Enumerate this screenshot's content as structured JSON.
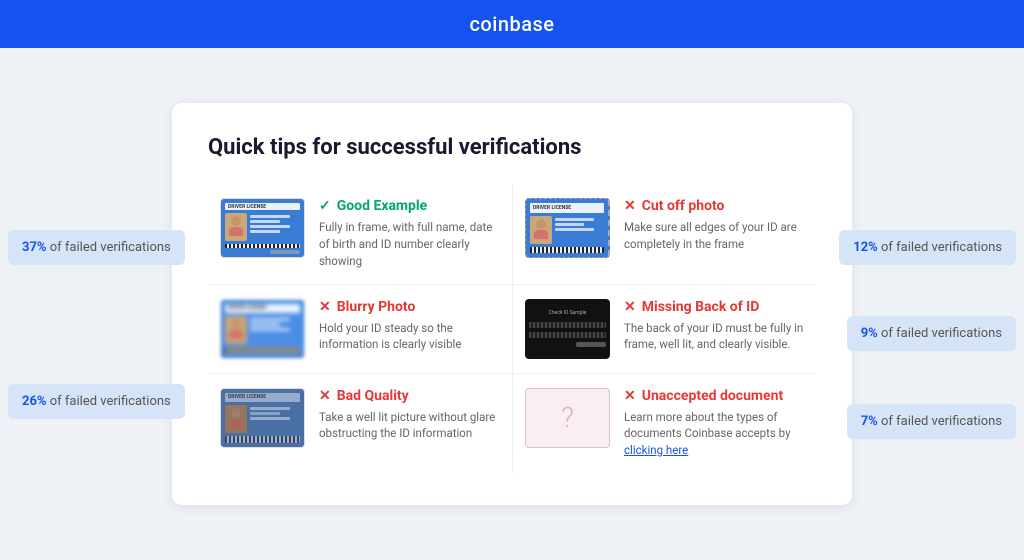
{
  "header": {
    "logo": "coinbase"
  },
  "page": {
    "title": "Quick tips for successful verifications"
  },
  "left_badges": [
    {
      "id": "badge-left-37",
      "pct": "37%",
      "text": " of failed verifications"
    },
    {
      "id": "badge-left-26",
      "pct": "26%",
      "text": " of failed verifications"
    }
  ],
  "right_badges": [
    {
      "id": "badge-right-12",
      "pct": "12%",
      "text": " of failed verifications"
    },
    {
      "id": "badge-right-9",
      "pct": "9%",
      "text": " of failed verifications"
    },
    {
      "id": "badge-right-7",
      "pct": "7%",
      "text": " of failed verifications"
    }
  ],
  "tips": [
    {
      "id": "good-example",
      "icon": "check",
      "title": "Good Example",
      "title_class": "good",
      "description": "Fully in frame, with full name, date of birth and ID number clearly showing",
      "image_type": "good"
    },
    {
      "id": "cut-off-photo",
      "icon": "x",
      "title": "Cut off photo",
      "title_class": "bad",
      "description": "Make sure all edges of your ID are completely in the frame",
      "image_type": "cutoff"
    },
    {
      "id": "blurry-photo",
      "icon": "x",
      "title": "Blurry Photo",
      "title_class": "bad",
      "description": "Hold your ID steady so the information is clearly visible",
      "image_type": "blurry"
    },
    {
      "id": "missing-back",
      "icon": "x",
      "title": "Missing Back of ID",
      "title_class": "bad",
      "description": "The back of your ID must be fully in frame, well lit, and clearly visible.",
      "image_type": "missing-back"
    },
    {
      "id": "bad-quality",
      "icon": "x",
      "title": "Bad Quality",
      "title_class": "bad",
      "description": "Take a well lit picture without glare obstructing the ID information",
      "image_type": "bad"
    },
    {
      "id": "unaccepted-document",
      "icon": "x",
      "title": "Unaccepted document",
      "title_class": "bad",
      "description": "Learn more about the types of documents Coinbase accepts by",
      "link_text": "clicking here",
      "image_type": "unaccepted"
    }
  ]
}
